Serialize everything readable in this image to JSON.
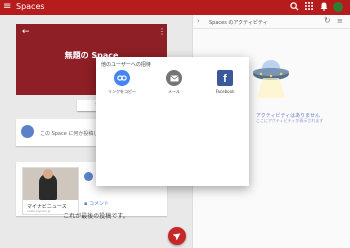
{
  "colors": {
    "appbar": "#b71c1c",
    "hero": "#8e1f26",
    "copylink": "#4285f4",
    "mail": "#757575",
    "facebook": "#3b5998",
    "fab": "#c62828"
  },
  "appbar": {
    "title": "Spaces",
    "icons": [
      "menu-icon",
      "search-icon",
      "apps-icon",
      "notifications-icon",
      "account-avatar"
    ]
  },
  "space": {
    "title": "無題の Space",
    "share_button": "SPA"
  },
  "prompt": {
    "text": "この Space に何か投稿してみよう"
  },
  "post": {
    "link_title": "マイナビニュース",
    "link_domain": "news.mynavi.jp",
    "comment_label": "コメント"
  },
  "feed_end": "これが最後の投稿です。",
  "activity": {
    "title": "Spaces のアクティビティ",
    "empty_title": "アクティビティはありません",
    "empty_sub": "ここにアクティビティが表示されます"
  },
  "share_dialog": {
    "title": "他のユーザーへの招待",
    "options": [
      {
        "label": "リンクをコピー",
        "icon": "link-icon"
      },
      {
        "label": "メール",
        "icon": "mail-icon"
      },
      {
        "label": "Facebook",
        "icon": "facebook-icon"
      }
    ]
  }
}
